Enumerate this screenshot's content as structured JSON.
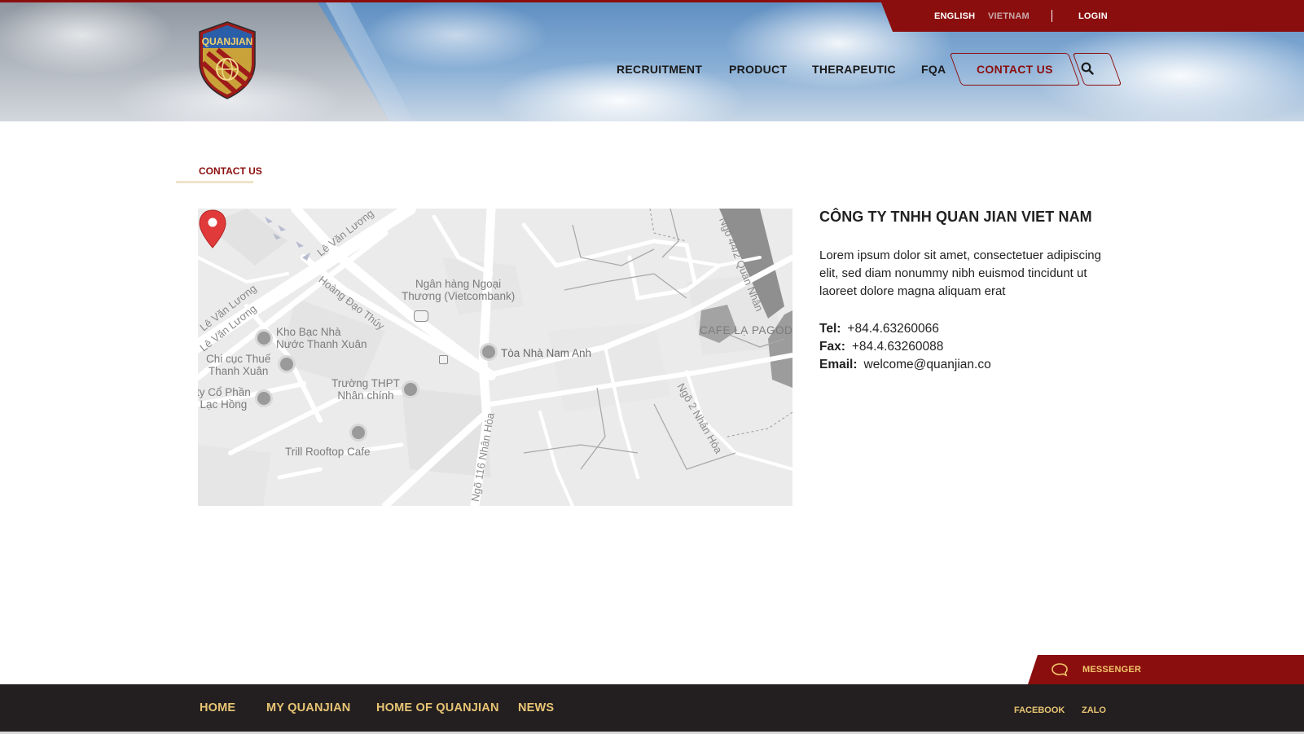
{
  "brand": {
    "logo_text": "QUANJIAN",
    "colors": {
      "primary": "#8b0e0e",
      "gold": "#e8c574",
      "footer_bg": "#231f20"
    }
  },
  "topbar": {
    "lang_english": "ENGLISH",
    "lang_vietnam": "VIETNAM",
    "login": "LOGIN"
  },
  "nav": {
    "items": [
      "RECRUITMENT",
      "PRODUCT",
      "THERAPEUTIC",
      "FQA"
    ],
    "contact": "CONTACT US",
    "search_icon": "search-icon"
  },
  "breadcrumb": {
    "label": "CONTACT US"
  },
  "map": {
    "pin_icon": "map-pin-icon",
    "streets": [
      "Lê Văn Lương",
      "Lê Văn Lương",
      "Lê Văn Lương",
      "Hoàng Đạo Thúy",
      "Ngõ 116 Nhân Hòa",
      "Ngõ 2 Nhân Hòa",
      "Ngõ 44/2 Quan Nhân"
    ],
    "places": [
      "Ngân hàng Ngoại\nThương (Vietcombank)",
      "Kho Bạc Nhà\nNước Thanh Xuân",
      "Chi cục Thuế\nThanh Xuân",
      "Trường THPT\nNhân chính",
      "ty Cổ Phần\nLạc Hồng",
      "Trill Rooftop Cafe",
      "Tòa Nhà Nam Anh",
      "CAFE LẠ PAGOD"
    ]
  },
  "company": {
    "name": "CÔNG TY TNHH QUAN JIAN VIET NAM",
    "description": "Lorem ipsum dolor sit amet, consectetuer adipiscing elit, sed diam nonummy nibh euismod tincidunt ut laoreet dolore magna aliquam erat",
    "tel_label": "Tel:",
    "tel": "+84.4.63260066",
    "fax_label": "Fax:",
    "fax": "+84.4.63260088",
    "email_label": "Email:",
    "email": "welcome@quanjian.co"
  },
  "messenger": {
    "label": "MESSENGER",
    "icon": "chat-bubble-icon"
  },
  "footer": {
    "links": [
      "HOME",
      "MY QUANJIAN",
      "HOME OF QUANJIAN",
      "NEWS"
    ],
    "social": [
      "FACEBOOK",
      "ZALO"
    ]
  }
}
